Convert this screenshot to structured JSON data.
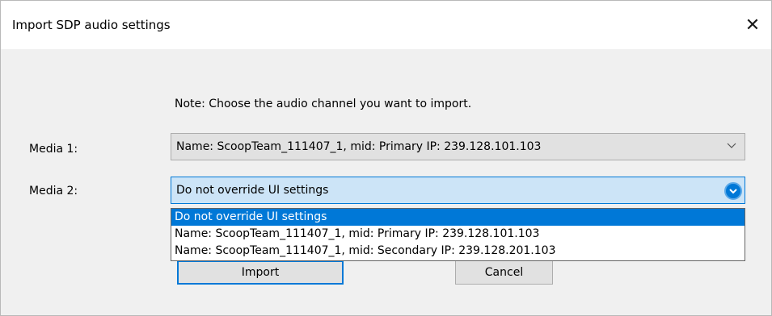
{
  "window": {
    "title": "Import SDP audio settings",
    "close_glyph": "✕"
  },
  "note": "Note: Choose the audio channel you want to import.",
  "media1": {
    "label": "Media 1:",
    "value": "Name: ScoopTeam_111407_1, mid: Primary IP: 239.128.101.103"
  },
  "media2": {
    "label": "Media 2:",
    "value": "Do not override UI settings",
    "options": [
      "Do not override UI settings",
      "Name: ScoopTeam_111407_1, mid: Primary IP: 239.128.101.103",
      "Name: ScoopTeam_111407_1, mid: Secondary IP: 239.128.201.103"
    ],
    "selected_index": 0
  },
  "buttons": {
    "import": "Import",
    "cancel": "Cancel"
  },
  "colors": {
    "accent": "#0078d7",
    "combo_focus_bg": "#cce4f7",
    "dialog_bg": "#f0f0f0"
  }
}
